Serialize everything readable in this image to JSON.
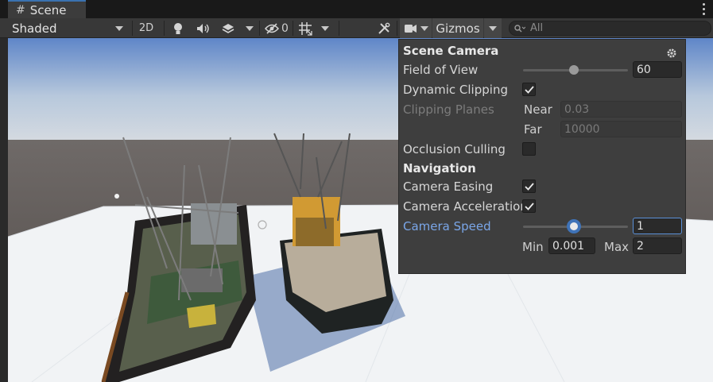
{
  "tab": {
    "title": "Scene"
  },
  "toolbar": {
    "draw_mode": "Shaded",
    "mode_2d": "2D",
    "hidden_count": "0",
    "gizmos_label": "Gizmos",
    "search_placeholder": "All"
  },
  "panel": {
    "title": "Scene Camera",
    "field_of_view": {
      "label": "Field of View",
      "value": "60",
      "slider_fraction": 0.48
    },
    "dynamic_clipping": {
      "label": "Dynamic Clipping",
      "checked": true
    },
    "clipping_planes": {
      "label": "Clipping Planes",
      "near_label": "Near",
      "near_value": "0.03",
      "far_label": "Far",
      "far_value": "10000"
    },
    "occlusion_culling": {
      "label": "Occlusion Culling",
      "checked": false
    },
    "navigation_title": "Navigation",
    "camera_easing": {
      "label": "Camera Easing",
      "checked": true
    },
    "camera_acceleration": {
      "label": "Camera Acceleration",
      "checked": true
    },
    "camera_speed": {
      "label": "Camera Speed",
      "value": "1",
      "slider_fraction": 0.5,
      "min_label": "Min",
      "min_value": "0.001",
      "max_label": "Max",
      "max_value": "2"
    }
  },
  "colors": {
    "accent": "#3a72b0",
    "speed_label": "#7aa6e8",
    "panel_bg": "#3e3e3e"
  }
}
